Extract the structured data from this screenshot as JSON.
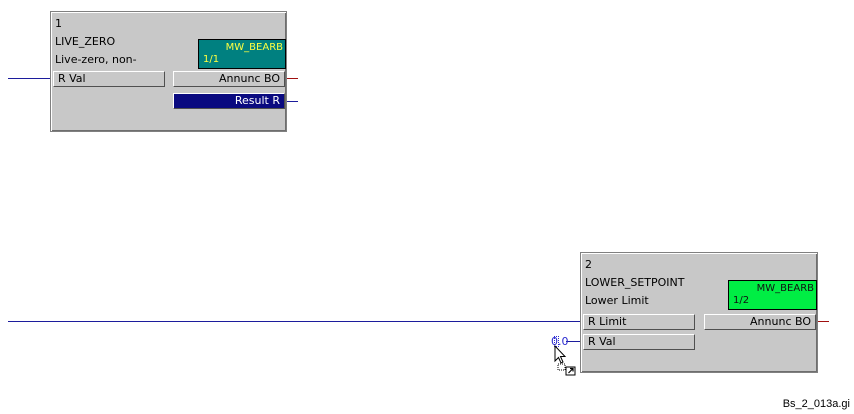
{
  "blocks": [
    {
      "number": "1",
      "name": "LIVE_ZERO",
      "description": "Live-zero, non-",
      "ref_line1": "MW_BEARB",
      "ref_line2": "1/1",
      "ref_color": "#008080",
      "inputs": [
        {
          "label": "R  Val"
        }
      ],
      "outputs": [
        {
          "label": "Annunc BO",
          "selected": false
        },
        {
          "label": "Result  R",
          "selected": true
        }
      ]
    },
    {
      "number": "2",
      "name": "LOWER_SETPOINT",
      "description": "Lower Limit",
      "ref_line1": "MW_BEARB",
      "ref_line2": "1/2",
      "ref_color": "#00ee44",
      "inputs": [
        {
          "label": "R  Limit"
        },
        {
          "label": "R  Val"
        }
      ],
      "outputs": [
        {
          "label": "Annunc BO",
          "selected": false
        }
      ]
    }
  ],
  "constant_value": "0.0",
  "wire_colors": {
    "input": "#1c1c9c",
    "output_red": "#a01010",
    "output_blue": "#1c1c9c"
  },
  "footer_label": "Bs_2_013a.gi"
}
